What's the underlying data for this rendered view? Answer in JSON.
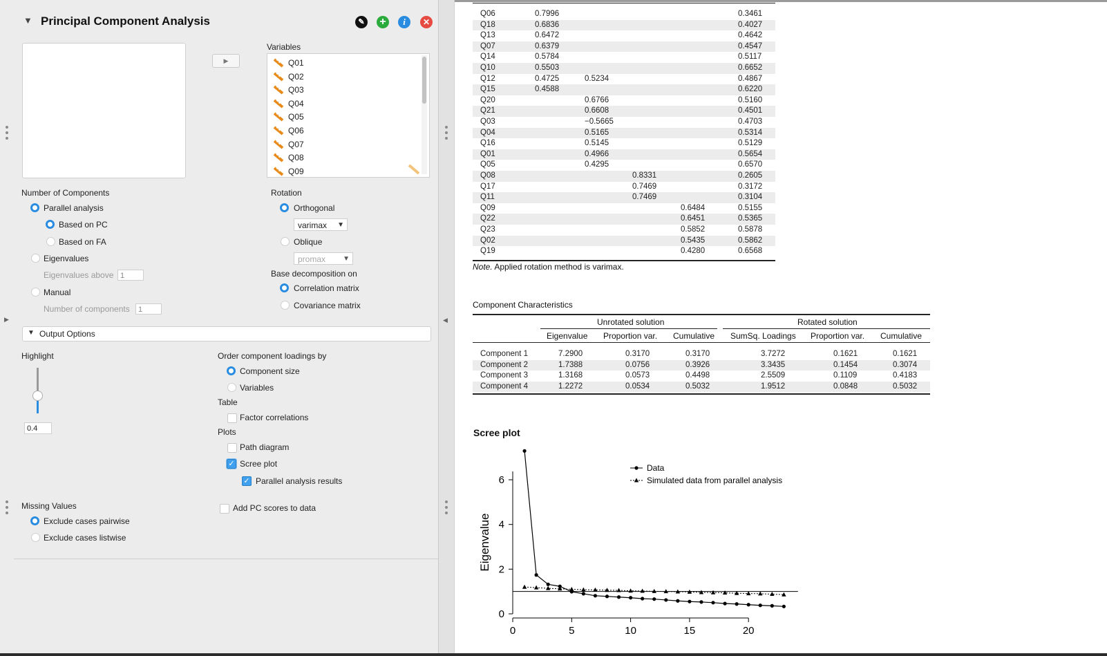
{
  "analysis": {
    "title": "Principal Component Analysis",
    "variables_label": "Variables",
    "variables": [
      "Q01",
      "Q02",
      "Q03",
      "Q04",
      "Q05",
      "Q06",
      "Q07",
      "Q08",
      "Q09"
    ]
  },
  "number_of_components": {
    "label": "Number of Components",
    "parallel": "Parallel analysis",
    "based_pc": "Based on PC",
    "based_fa": "Based on FA",
    "eigenvalues": "Eigenvalues",
    "eigen_above_label": "Eigenvalues above",
    "eigen_above_value": "1",
    "manual": "Manual",
    "num_components_label": "Number of components",
    "num_components_value": "1"
  },
  "rotation": {
    "label": "Rotation",
    "orthogonal": "Orthogonal",
    "orthogonal_method": "varimax",
    "oblique": "Oblique",
    "oblique_method": "promax",
    "base_label": "Base decomposition on",
    "correlation": "Correlation matrix",
    "covariance": "Covariance matrix"
  },
  "output": {
    "section_label": "Output Options",
    "highlight_label": "Highlight",
    "highlight_value": "0.4",
    "highlight_fraction": 0.4,
    "order_label": "Order component loadings by",
    "order_size": "Component size",
    "order_variables": "Variables",
    "table_label": "Table",
    "factor_corr": "Factor correlations",
    "plots_label": "Plots",
    "path_diagram": "Path diagram",
    "scree_plot": "Scree plot",
    "parallel_results": "Parallel analysis results",
    "add_scores": "Add PC scores to data",
    "missing_label": "Missing Values",
    "pairwise": "Exclude cases pairwise",
    "listwise": "Exclude cases listwise"
  },
  "loadings": {
    "rows": [
      [
        "Q06",
        "0.7996",
        "",
        "",
        "",
        "0.3461"
      ],
      [
        "Q18",
        "0.6836",
        "",
        "",
        "",
        "0.4027"
      ],
      [
        "Q13",
        "0.6472",
        "",
        "",
        "",
        "0.4642"
      ],
      [
        "Q07",
        "0.6379",
        "",
        "",
        "",
        "0.4547"
      ],
      [
        "Q14",
        "0.5784",
        "",
        "",
        "",
        "0.5117"
      ],
      [
        "Q10",
        "0.5503",
        "",
        "",
        "",
        "0.6652"
      ],
      [
        "Q12",
        "0.4725",
        "0.5234",
        "",
        "",
        "0.4867"
      ],
      [
        "Q15",
        "0.4588",
        "",
        "",
        "",
        "0.6220"
      ],
      [
        "Q20",
        "",
        "0.6766",
        "",
        "",
        "0.5160"
      ],
      [
        "Q21",
        "",
        "0.6608",
        "",
        "",
        "0.4501"
      ],
      [
        "Q03",
        "",
        "−0.5665",
        "",
        "",
        "0.4703"
      ],
      [
        "Q04",
        "",
        "0.5165",
        "",
        "",
        "0.5314"
      ],
      [
        "Q16",
        "",
        "0.5145",
        "",
        "",
        "0.5129"
      ],
      [
        "Q01",
        "",
        "0.4966",
        "",
        "",
        "0.5654"
      ],
      [
        "Q05",
        "",
        "0.4295",
        "",
        "",
        "0.6570"
      ],
      [
        "Q08",
        "",
        "",
        "0.8331",
        "",
        "0.2605"
      ],
      [
        "Q17",
        "",
        "",
        "0.7469",
        "",
        "0.3172"
      ],
      [
        "Q11",
        "",
        "",
        "0.7469",
        "",
        "0.3104"
      ],
      [
        "Q09",
        "",
        "",
        "",
        "0.6484",
        "0.5155"
      ],
      [
        "Q22",
        "",
        "",
        "",
        "0.6451",
        "0.5365"
      ],
      [
        "Q23",
        "",
        "",
        "",
        "0.5852",
        "0.5878"
      ],
      [
        "Q02",
        "",
        "",
        "",
        "0.5435",
        "0.5862"
      ],
      [
        "Q19",
        "",
        "",
        "",
        "0.4280",
        "0.6568"
      ]
    ],
    "note_prefix": "Note.",
    "note_text": " Applied rotation method is varimax."
  },
  "characteristics": {
    "title": "Component Characteristics",
    "unrotated": "Unrotated solution",
    "rotated": "Rotated solution",
    "headers": [
      "Eigenvalue",
      "Proportion var.",
      "Cumulative",
      "SumSq. Loadings",
      "Proportion var.",
      "Cumulative"
    ],
    "rows": [
      [
        "Component 1",
        "7.2900",
        "0.3170",
        "0.3170",
        "3.7272",
        "0.1621",
        "0.1621"
      ],
      [
        "Component 2",
        "1.7388",
        "0.0756",
        "0.3926",
        "3.3435",
        "0.1454",
        "0.3074"
      ],
      [
        "Component 3",
        "1.3168",
        "0.0573",
        "0.4498",
        "2.5509",
        "0.1109",
        "0.4183"
      ],
      [
        "Component 4",
        "1.2272",
        "0.0534",
        "0.5032",
        "1.9512",
        "0.0848",
        "0.5032"
      ]
    ]
  },
  "scree_title": "Scree plot",
  "chart_data": {
    "type": "line",
    "ylabel": "Eigenvalue",
    "xlabel": "",
    "xlim": [
      0,
      24
    ],
    "ylim": [
      0,
      7.3
    ],
    "xticks": [
      0,
      5,
      10,
      15,
      20
    ],
    "yticks": [
      0,
      2,
      4,
      6
    ],
    "reference_line_y": 1,
    "legend_position": "top-right",
    "series": [
      {
        "name": "Data",
        "marker": "circle",
        "line": "solid",
        "x": [
          1,
          2,
          3,
          4,
          5,
          6,
          7,
          8,
          9,
          10,
          11,
          12,
          13,
          14,
          15,
          16,
          17,
          18,
          19,
          20,
          21,
          22,
          23
        ],
        "values": [
          7.29,
          1.74,
          1.32,
          1.23,
          0.99,
          0.9,
          0.81,
          0.78,
          0.75,
          0.72,
          0.68,
          0.66,
          0.62,
          0.58,
          0.55,
          0.53,
          0.5,
          0.46,
          0.44,
          0.41,
          0.38,
          0.36,
          0.33
        ]
      },
      {
        "name": "Simulated data from parallel analysis",
        "marker": "triangle",
        "line": "dotted",
        "x": [
          1,
          2,
          3,
          4,
          5,
          6,
          7,
          8,
          9,
          10,
          11,
          12,
          13,
          14,
          15,
          16,
          17,
          18,
          19,
          20,
          21,
          22,
          23
        ],
        "values": [
          1.2,
          1.17,
          1.14,
          1.12,
          1.1,
          1.08,
          1.07,
          1.06,
          1.05,
          1.03,
          1.02,
          1.01,
          1.0,
          0.99,
          0.98,
          0.96,
          0.95,
          0.94,
          0.92,
          0.91,
          0.9,
          0.88,
          0.86
        ]
      }
    ]
  }
}
